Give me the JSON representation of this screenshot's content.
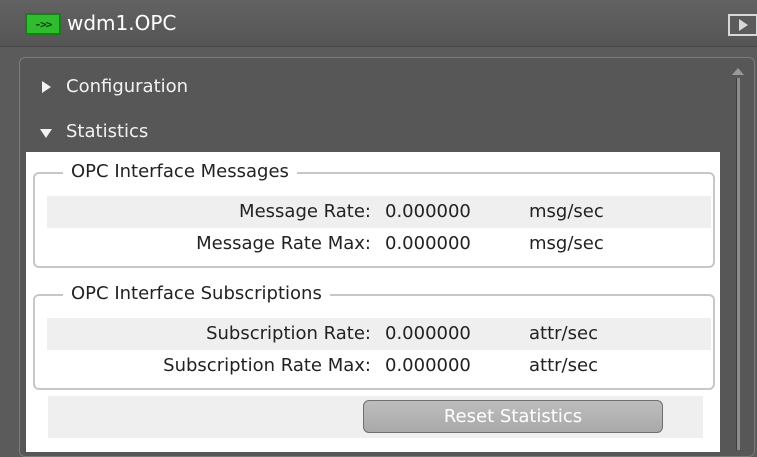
{
  "window": {
    "icon": "opc-gateway-icon",
    "title": "wdm1.OPC"
  },
  "sections": {
    "configuration": {
      "label": "Configuration",
      "expanded": false
    },
    "statistics": {
      "label": "Statistics",
      "expanded": true
    }
  },
  "messages": {
    "group_title": "OPC Interface Messages",
    "rows": [
      {
        "label": "Message Rate:",
        "value": "0.000000",
        "unit": "msg/sec"
      },
      {
        "label": "Message Rate Max:",
        "value": "0.000000",
        "unit": "msg/sec"
      }
    ]
  },
  "subscriptions": {
    "group_title": "OPC Interface Subscriptions",
    "rows": [
      {
        "label": "Subscription Rate:",
        "value": "0.000000",
        "unit": "attr/sec"
      },
      {
        "label": "Subscription Rate Max:",
        "value": "0.000000",
        "unit": "attr/sec"
      }
    ]
  },
  "actions": {
    "reset_label": "Reset Statistics"
  },
  "colors": {
    "accent_icon": "#2fbd2f",
    "panel_bg": "#575757",
    "content_bg": "#ffffff"
  }
}
